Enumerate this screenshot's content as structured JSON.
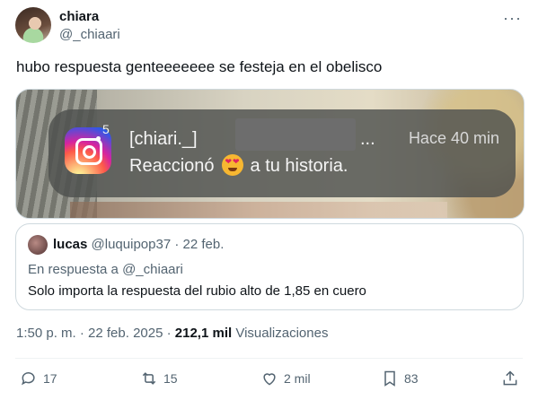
{
  "author": {
    "display_name": "chiara",
    "handle": "@_chiaari"
  },
  "tweet": {
    "text": "hubo respuesta genteeeeeee se festeja en el obelisco"
  },
  "notification": {
    "app": "instagram-icon",
    "badge": "5",
    "user": "[chiari._]",
    "ellipsis": "...",
    "time": "Hace 40 min",
    "message_before": "Reaccionó",
    "message_after": "a tu historia."
  },
  "quote": {
    "display_name": "lucas",
    "handle": "@luquipop37",
    "date": "· 22 feb.",
    "reply_prefix": "En respuesta a",
    "reply_to": "@_chiaari",
    "text": "Solo importa la respuesta del rubio alto de 1,85 en cuero"
  },
  "meta": {
    "timestamp": "1:50 p. m. · 22 feb. 2025 ·",
    "views_count": "212,1 mil",
    "views_label": "Visualizaciones"
  },
  "actions": {
    "replies": "17",
    "retweets": "15",
    "likes": "2 mil",
    "bookmarks": "83"
  },
  "colors": {
    "text": "#0f1419",
    "secondary": "#536471",
    "border": "#cfd9de"
  }
}
